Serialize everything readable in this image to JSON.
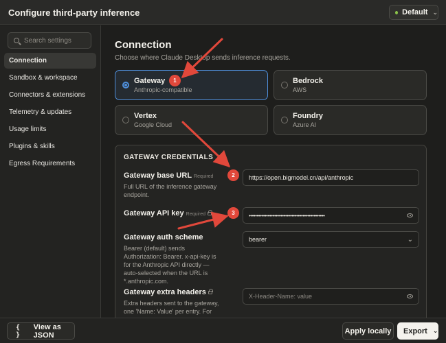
{
  "window": {
    "title": "Configure third-party inference",
    "profile_label": "Default"
  },
  "sidebar": {
    "search_placeholder": "Search settings",
    "items": [
      {
        "label": "Connection",
        "active": true
      },
      {
        "label": "Sandbox & workspace"
      },
      {
        "label": "Connectors & extensions"
      },
      {
        "label": "Telemetry & updates"
      },
      {
        "label": "Usage limits"
      },
      {
        "label": "Plugins & skills"
      },
      {
        "label": "Egress Requirements"
      }
    ]
  },
  "main": {
    "title": "Connection",
    "description": "Choose where Claude Desktop sends inference requests.",
    "providers": [
      {
        "name": "Gateway",
        "detail": "Anthropic-compatible",
        "selected": true
      },
      {
        "name": "Bedrock",
        "detail": "AWS"
      },
      {
        "name": "Vertex",
        "detail": "Google Cloud"
      },
      {
        "name": "Foundry",
        "detail": "Azure AI"
      }
    ],
    "credentials": {
      "title": "GATEWAY CREDENTIALS",
      "fields": [
        {
          "label": "Gateway base URL",
          "badge": "Required",
          "help": "Full URL of the inference gateway endpoint.",
          "value": "https://open.bigmodel.cn/api/anthropic"
        },
        {
          "label": "Gateway API key",
          "badge": "Required",
          "value": "••••••••••••••••••••••••••••••••••••••••••••••••"
        },
        {
          "label": "Gateway auth scheme",
          "help": "Bearer (default) sends Authorization: Bearer. x-api-key is for the Anthropic API directly — auto-selected when the URL is *.anthropic.com.",
          "value": "bearer"
        },
        {
          "label": "Gateway extra headers",
          "help": "Extra headers sent to the gateway, one 'Name: Value' per entry. For",
          "placeholder": "X-Header-Name: value"
        }
      ]
    }
  },
  "footer": {
    "json_label": "View as JSON",
    "apply_label": "Apply locally",
    "export_label": "Export"
  },
  "annotations": {
    "badges": [
      "1",
      "2",
      "3"
    ],
    "color": "#e1483b"
  },
  "icons": {
    "status": "green-dot-icon",
    "search": "search-icon",
    "lock": "lock-icon",
    "eye": "eye-icon",
    "chevron": "chevron-down-icon"
  }
}
